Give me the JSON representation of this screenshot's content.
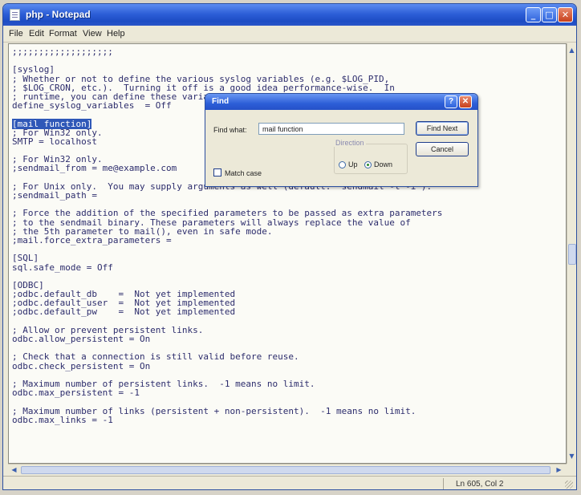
{
  "window": {
    "title": "php - Notepad"
  },
  "menu": [
    "File",
    "Edit",
    "Format",
    "View",
    "Help"
  ],
  "editor": {
    "lines": [
      ";;;;;;;;;;;;;;;;;;;",
      "",
      "[syslog]",
      "; Whether or not to define the various syslog variables (e.g. $LOG_PID,",
      "; $LOG_CRON, etc.).  Turning it off is a good idea performance-wise.  In",
      "; runtime, you can define these variables by calling define_syslog_variables().",
      "define_syslog_variables  = Off",
      "",
      "[mail function]",
      "; For Win32 only.",
      "SMTP = localhost",
      "",
      "; For Win32 only.",
      ";sendmail_from = me@example.com",
      "",
      "; For Unix only.  You may supply arguments as well (default: \"sendmail -t -i\").",
      ";sendmail_path =",
      "",
      "; Force the addition of the specified parameters to be passed as extra parameters",
      "; to the sendmail binary. These parameters will always replace the value of",
      "; the 5th parameter to mail(), even in safe mode.",
      ";mail.force_extra_parameters =",
      "",
      "[SQL]",
      "sql.safe_mode = Off",
      "",
      "[ODBC]",
      ";odbc.default_db    =  Not yet implemented",
      ";odbc.default_user  =  Not yet implemented",
      ";odbc.default_pw    =  Not yet implemented",
      "",
      "; Allow or prevent persistent links.",
      "odbc.allow_persistent = On",
      "",
      "; Check that a connection is still valid before reuse.",
      "odbc.check_persistent = On",
      "",
      "; Maximum number of persistent links.  -1 means no limit.",
      "odbc.max_persistent = -1",
      "",
      "; Maximum number of links (persistent + non-persistent).  -1 means no limit.",
      "odbc.max_links = -1"
    ],
    "selected_line_index": 8
  },
  "find_dialog": {
    "title": "Find",
    "find_what_label": "Find what:",
    "find_what_value": "mail function",
    "find_next_label": "Find Next",
    "cancel_label": "Cancel",
    "direction_label": "Direction",
    "up_label": "Up",
    "down_label": "Down",
    "direction_selected": "Down",
    "match_case_label": "Match case",
    "match_case_checked": false
  },
  "statusbar": {
    "position": "Ln 605, Col 2"
  },
  "icons": {
    "app": "notepad-icon",
    "minimize": "minimize-icon",
    "maximize": "maximize-icon",
    "close": "close-icon",
    "help": "help-icon"
  }
}
